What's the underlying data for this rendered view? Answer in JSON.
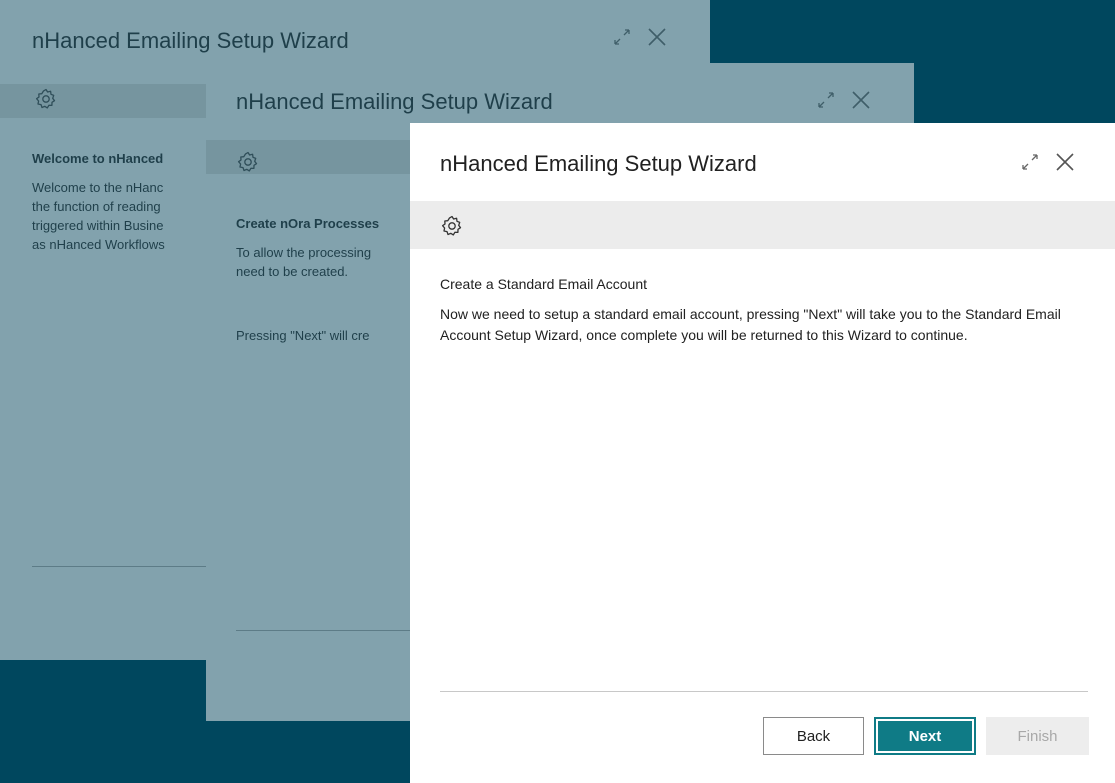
{
  "background_color": "#00475e",
  "accent_color": "#0f7b86",
  "wizard_title": "nHanced Emailing Setup Wizard",
  "icons": {
    "expand": "expand-icon",
    "close": "close-icon",
    "settings": "gear-icon"
  },
  "dialogs": [
    {
      "heading": "Welcome to nHanced",
      "text": "Welcome to the nHanc\nthe function of reading\ntriggered within Busine\nas nHanced Workflows"
    },
    {
      "heading": "Create nOra Processes",
      "text": "To allow the processing\nneed to be created.",
      "text2": "Pressing \"Next\" will cre"
    },
    {
      "heading": "Create a Standard Email Account",
      "text": "Now we need to setup a standard email account, pressing \"Next\" will take you to the Standard Email Account Setup Wizard, once complete you will be returned to this Wizard to continue."
    }
  ],
  "buttons": {
    "back": "Back",
    "next": "Next",
    "finish": "Finish"
  }
}
